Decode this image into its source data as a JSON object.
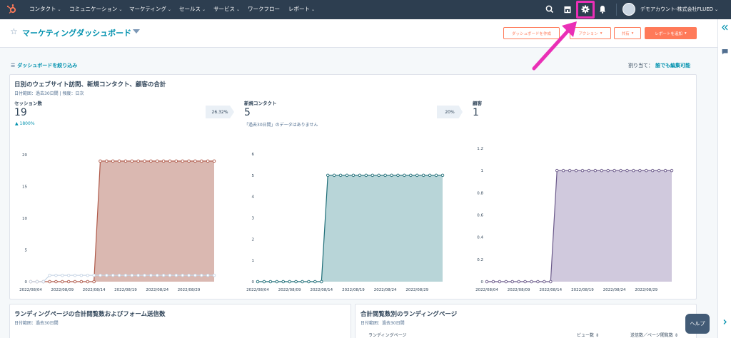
{
  "nav": {
    "items": [
      {
        "label": "コンタクト",
        "dropdown": true
      },
      {
        "label": "コミュニケーション",
        "dropdown": true
      },
      {
        "label": "マーケティング",
        "dropdown": true
      },
      {
        "label": "セールス",
        "dropdown": true
      },
      {
        "label": "サービス",
        "dropdown": true
      },
      {
        "label": "ワークフロー",
        "dropdown": false
      },
      {
        "label": "レポート",
        "dropdown": true
      }
    ],
    "account_name": "デモアカウント-株式会社FLUED",
    "icons": [
      "hubspot-logo",
      "search-icon",
      "marketplace-icon",
      "gear-icon",
      "bell-icon",
      "avatar"
    ],
    "highlight_color": "#ea2fb6",
    "nav_bg": "#2d3e50"
  },
  "header": {
    "title": "マーケティングダッシュボード",
    "buttons": {
      "create": "ダッシュボードを作成",
      "actions": "アクション",
      "share": "共有",
      "add_report": "レポートを追加"
    },
    "accent_color": "#ff7a59"
  },
  "filter_bar": {
    "filter_label": "ダッシュボードを絞り込み",
    "assign_label": "割り当て：",
    "assign_value": "誰でも編集可能"
  },
  "report1": {
    "title": "日別のウェブサイト訪問、新規コンタクト、顧客の合計",
    "meta": "日付範囲：過去30日間 | 頻度：日次",
    "metrics": [
      {
        "label": "セッション数",
        "value": "19",
        "badge": "26.32%",
        "change": "1800%"
      },
      {
        "label": "新規コンタクト",
        "value": "5",
        "badge": "20%",
        "note": "「過去30日間」のデータはありません"
      },
      {
        "label": "顧客",
        "value": "1"
      }
    ]
  },
  "report2": {
    "title": "ランディングページの合計閲覧数およびフォーム送信数",
    "meta": "日付範囲：過去30日間"
  },
  "report3": {
    "title": "合計閲覧数別のランディングページ",
    "meta": "日付範囲：過去30日間",
    "columns": [
      "ランディングページ",
      "ビュー数",
      "送信数／ページ閲覧数"
    ]
  },
  "help_label": "ヘルプ",
  "chart_data": [
    {
      "type": "area",
      "x": [
        "2022/08/04",
        "2022/08/05",
        "2022/08/06",
        "2022/08/07",
        "2022/08/08",
        "2022/08/09",
        "2022/08/10",
        "2022/08/11",
        "2022/08/12",
        "2022/08/13",
        "2022/08/14",
        "2022/08/15",
        "2022/08/16",
        "2022/08/17",
        "2022/08/18",
        "2022/08/19",
        "2022/08/20",
        "2022/08/21",
        "2022/08/22",
        "2022/08/23",
        "2022/08/24",
        "2022/08/25",
        "2022/08/26",
        "2022/08/27",
        "2022/08/28",
        "2022/08/29",
        "2022/08/30",
        "2022/08/31",
        "2022/09/01",
        "2022/09/02"
      ],
      "xticks": [
        "2022/08/04",
        "2022/08/09",
        "2022/08/14",
        "2022/08/19",
        "2022/08/24",
        "2022/08/29"
      ],
      "series": [
        {
          "values": [
            0,
            0,
            0,
            0,
            0,
            0,
            0,
            0,
            0,
            0,
            0,
            19,
            19,
            19,
            19,
            19,
            19,
            19,
            19,
            19,
            19,
            19,
            19,
            19,
            19,
            19,
            19,
            19,
            19,
            19
          ],
          "color": "#b05a4a",
          "fill": "#d6b0a8"
        },
        {
          "values": [
            0,
            0,
            0,
            1,
            1,
            1,
            1,
            1,
            1,
            1,
            1,
            1,
            1,
            1,
            1,
            1,
            1,
            1,
            1,
            1,
            1,
            1,
            1,
            1,
            1,
            1,
            1,
            1,
            1,
            1
          ],
          "color": "#c8d6e6",
          "fill": "none"
        }
      ],
      "ylim": [
        0,
        20
      ],
      "yticks": [
        0,
        5,
        10,
        15,
        20
      ]
    },
    {
      "type": "area",
      "x": [
        "2022/08/04",
        "2022/08/05",
        "2022/08/06",
        "2022/08/07",
        "2022/08/08",
        "2022/08/09",
        "2022/08/10",
        "2022/08/11",
        "2022/08/12",
        "2022/08/13",
        "2022/08/14",
        "2022/08/15",
        "2022/08/16",
        "2022/08/17",
        "2022/08/18",
        "2022/08/19",
        "2022/08/20",
        "2022/08/21",
        "2022/08/22",
        "2022/08/23",
        "2022/08/24",
        "2022/08/25",
        "2022/08/26",
        "2022/08/27",
        "2022/08/28",
        "2022/08/29",
        "2022/08/30",
        "2022/08/31",
        "2022/09/01",
        "2022/09/02"
      ],
      "xticks": [
        "2022/08/04",
        "2022/08/09",
        "2022/08/14",
        "2022/08/19",
        "2022/08/24",
        "2022/08/29"
      ],
      "series": [
        {
          "values": [
            0,
            0,
            0,
            0,
            0,
            0,
            0,
            0,
            0,
            0,
            0,
            5,
            5,
            5,
            5,
            5,
            5,
            5,
            5,
            5,
            5,
            5,
            5,
            5,
            5,
            5,
            5,
            5,
            5,
            5
          ],
          "color": "#1f6e78",
          "fill": "#b0d0d4"
        }
      ],
      "ylim": [
        0,
        6
      ],
      "yticks": [
        0,
        1,
        2,
        3,
        4,
        5,
        6
      ]
    },
    {
      "type": "area",
      "x": [
        "2022/08/04",
        "2022/08/05",
        "2022/08/06",
        "2022/08/07",
        "2022/08/08",
        "2022/08/09",
        "2022/08/10",
        "2022/08/11",
        "2022/08/12",
        "2022/08/13",
        "2022/08/14",
        "2022/08/15",
        "2022/08/16",
        "2022/08/17",
        "2022/08/18",
        "2022/08/19",
        "2022/08/20",
        "2022/08/21",
        "2022/08/22",
        "2022/08/23",
        "2022/08/24",
        "2022/08/25",
        "2022/08/26",
        "2022/08/27",
        "2022/08/28",
        "2022/08/29",
        "2022/08/30",
        "2022/08/31",
        "2022/09/01",
        "2022/09/02"
      ],
      "xticks": [
        "2022/08/04",
        "2022/08/09",
        "2022/08/14",
        "2022/08/19",
        "2022/08/24",
        "2022/08/29"
      ],
      "series": [
        {
          "values": [
            0,
            0,
            0,
            0,
            0,
            0,
            0,
            0,
            0,
            0,
            0,
            1,
            1,
            1,
            1,
            1,
            1,
            1,
            1,
            1,
            1,
            1,
            1,
            1,
            1,
            1,
            1,
            1,
            1,
            1
          ],
          "color": "#6b5a8a",
          "fill": "#cbc3d9"
        }
      ],
      "ylim": [
        0,
        1.2
      ],
      "yticks": [
        0,
        0.2,
        0.4,
        0.6,
        0.8,
        1,
        1.2
      ]
    }
  ]
}
